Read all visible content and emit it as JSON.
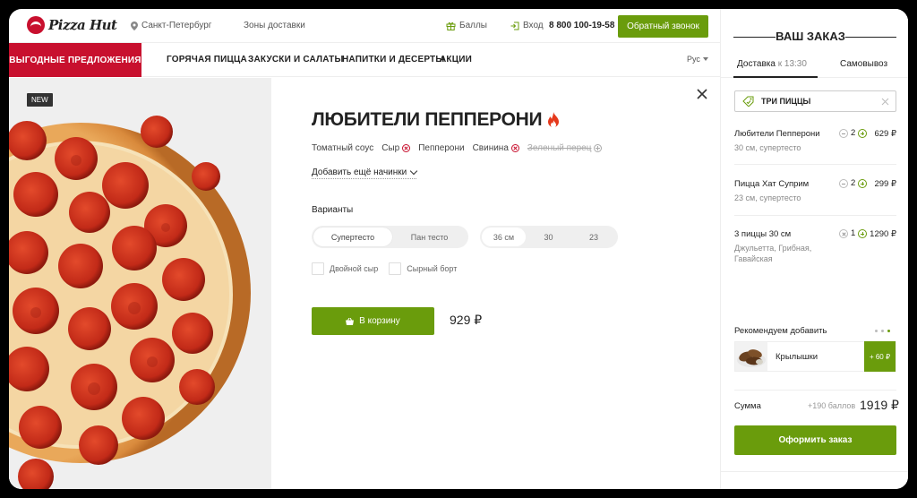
{
  "brand": {
    "logo_text": "Pizza Hut"
  },
  "header": {
    "city": "Санкт-Петербург",
    "zones": "Зоны доставки",
    "points": "Баллы",
    "login": "Вход",
    "phone": "8 800 100-19-58",
    "callback_label": "Обратный звонок"
  },
  "nav": {
    "promo": "ВЫГОДНЫЕ ПРЕДЛОЖЕНИЯ",
    "items": [
      "ГОРЯЧАЯ ПИЦЦА",
      "ЗАКУСКИ И САЛАТЫ",
      "НАПИТКИ И ДЕСЕРТЫ",
      "АКЦИИ"
    ],
    "lang": "Рус"
  },
  "product": {
    "badge": "NEW",
    "title": "ЛЮБИТЕЛИ ПЕППЕРОНИ",
    "ingredients": [
      {
        "name": "Томатный соус",
        "control": "none"
      },
      {
        "name": "Сыр",
        "control": "remove"
      },
      {
        "name": "Пепперони",
        "control": "none"
      },
      {
        "name": "Свинина",
        "control": "remove"
      },
      {
        "name": "Зеленый перец",
        "control": "add",
        "removed": true
      }
    ],
    "add_more": "Добавить ещё начинки",
    "variants_label": "Варианты",
    "dough_options": [
      "Супертесто",
      "Пан тесто"
    ],
    "dough_selected": "Супертесто",
    "size_options": [
      "36 см",
      "30",
      "23"
    ],
    "size_selected": "36 см",
    "extras": [
      "Двойной сыр",
      "Сырный борт"
    ],
    "cart_label": "В корзину",
    "price": "929 ₽"
  },
  "order": {
    "title": "ВАШ ЗАКАЗ",
    "tab_delivery": "Доставка",
    "tab_delivery_time": "к 13:30",
    "tab_pickup": "Самовывоз",
    "promo_code": "ТРИ ПИЦЦЫ",
    "items": [
      {
        "name": "Любители Пепперони",
        "sub": "30 см, супертесто",
        "qty": "2",
        "price": "629 ₽",
        "left_control": "minus"
      },
      {
        "name": "Пицца Хат Суприм",
        "sub": "23 см, супертесто",
        "qty": "2",
        "price": "299 ₽",
        "left_control": "minus"
      },
      {
        "name": "3 пиццы 30 см",
        "sub": "Джульетта, Грибная, Гавайская",
        "qty": "1",
        "price": "1290 ₽",
        "left_control": "remove"
      }
    ],
    "recommend_label": "Рекомендуем добавить",
    "recommend_item": "Крылышки",
    "recommend_add": "+ 60 ₽",
    "sum_label": "Сумма",
    "bonus": "+190 баллов",
    "total": "1919 ₽",
    "checkout_label": "Оформить заказ"
  },
  "colors": {
    "brand_red": "#c8102e",
    "accent_green": "#6a9c0c"
  },
  "icons": [
    "pizza-hut-logo-icon",
    "location-pin-icon",
    "gift-icon",
    "login-icon",
    "chevron-down-icon",
    "close-icon",
    "fire-icon",
    "remove-icon",
    "add-icon",
    "basket-icon",
    "promo-tag-icon",
    "minus-icon",
    "plus-icon"
  ]
}
